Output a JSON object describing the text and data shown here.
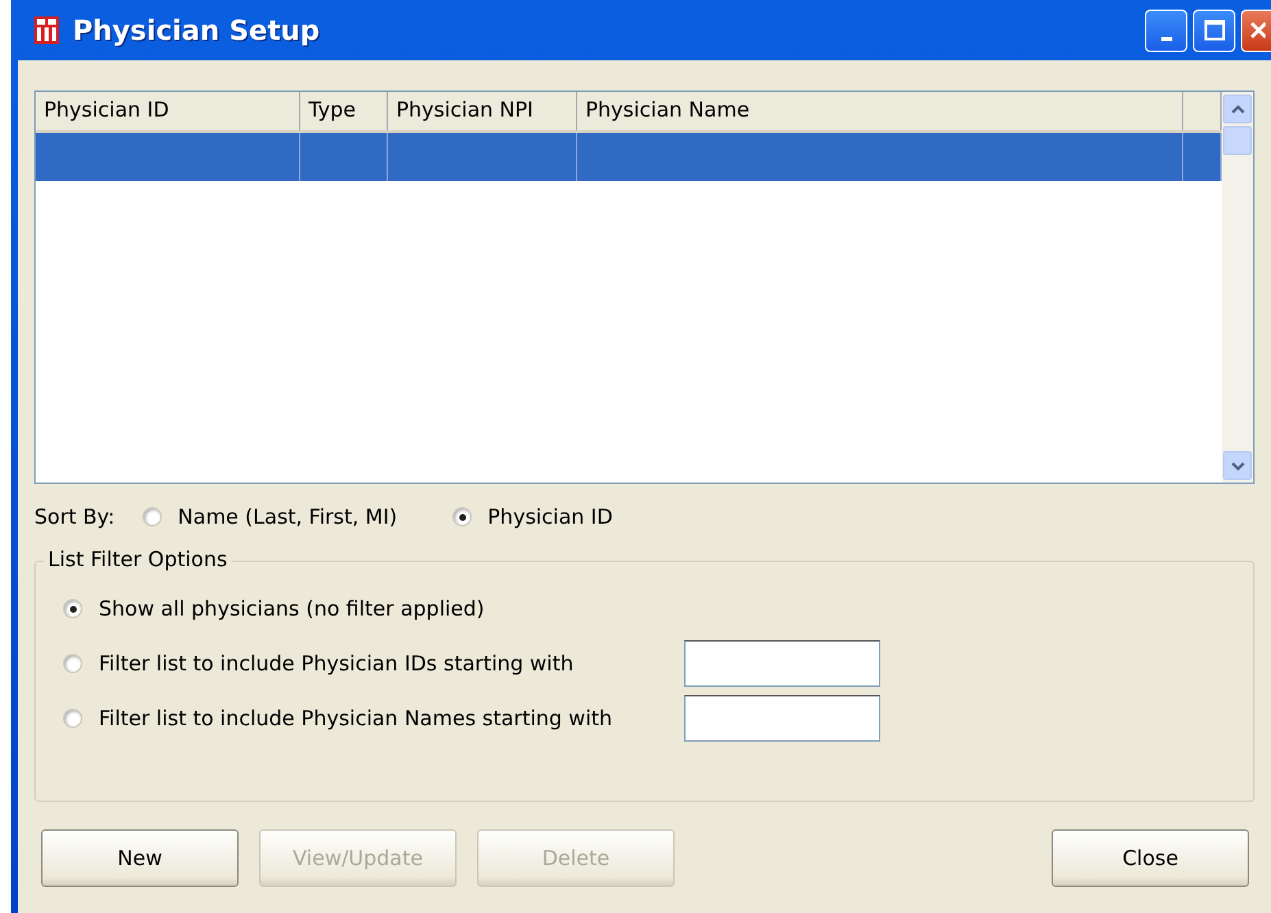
{
  "window": {
    "title": "Physician Setup"
  },
  "table": {
    "columns": [
      "Physician ID",
      "Type",
      "Physician NPI",
      "Physician Name"
    ],
    "rows": [
      {
        "selected": true
      }
    ]
  },
  "sort_by": {
    "label": "Sort By:",
    "options": [
      {
        "label": "Name (Last, First, MI)",
        "selected": false
      },
      {
        "label": "Physician ID",
        "selected": true
      }
    ]
  },
  "filter_group": {
    "title": "List Filter Options",
    "options": [
      {
        "label": "Show all physicians (no filter applied)",
        "selected": true,
        "kind": "plain"
      },
      {
        "label": "Filter list to include Physician IDs starting with",
        "selected": false,
        "kind": "field"
      },
      {
        "label": "Filter list to include Physician Names starting with",
        "selected": false,
        "kind": "field"
      }
    ]
  },
  "buttons": [
    {
      "label": "New",
      "disabled": false
    },
    {
      "label": "View/Update",
      "disabled": true
    },
    {
      "label": "Delete",
      "disabled": true
    },
    {
      "label": "Close",
      "disabled": false
    }
  ]
}
